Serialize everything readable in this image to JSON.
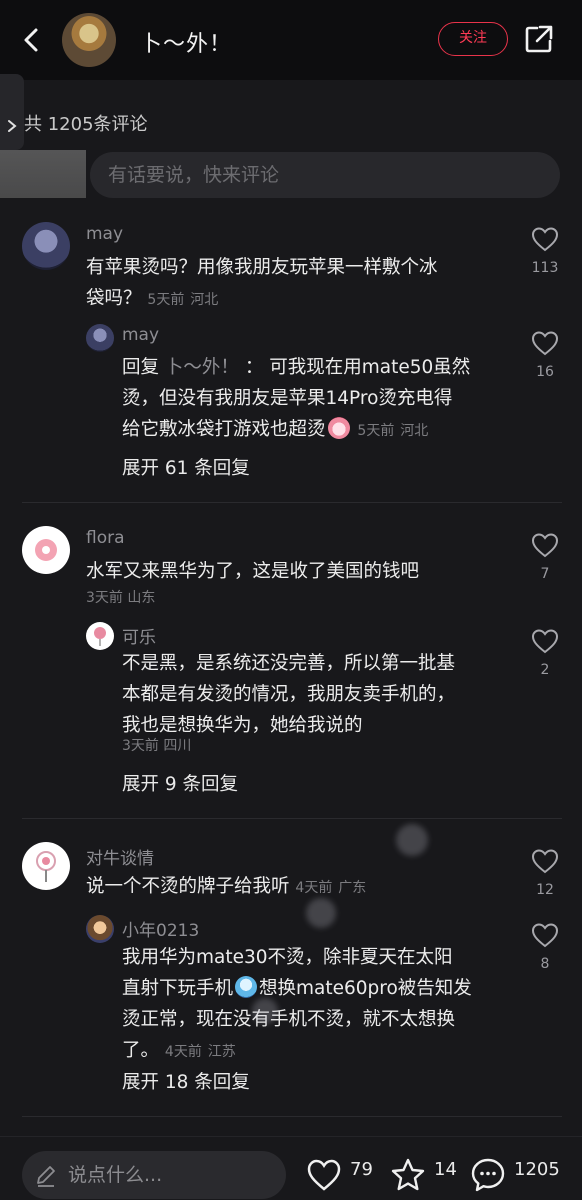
{
  "header": {
    "title": "卜～外！",
    "follow_label": "关注"
  },
  "comments_header": {
    "count_label": "共 1205条评论",
    "input_placeholder": "有话要说，快来评论"
  },
  "comments": [
    {
      "user": "may",
      "line1": "有苹果烫吗？用像我朋友玩苹果一样敷个冰",
      "line2": "袋吗？",
      "time": "5天前",
      "location": "河北",
      "likes": "113",
      "reply": {
        "user": "may",
        "prefix": "回复",
        "reply_to": "卜～外！",
        "colon": "：",
        "line1": "可我现在用mate50虽然",
        "line2": "烫，但没有我朋友是苹果14Pro烫充电得",
        "line3": "给它敷冰袋打游戏也超烫",
        "time": "5天前",
        "location": "河北",
        "likes": "16"
      },
      "expand_label": "展开 61 条回复"
    },
    {
      "user": "flora",
      "line1": "水军又来黑华为了，这是收了美国的钱吧",
      "time": "3天前",
      "location": "山东",
      "likes": "7",
      "reply": {
        "user": "可乐",
        "line1": "不是黑，是系统还没完善，所以第一批基",
        "line2": "本都是有发烫的情况，我朋友卖手机的，",
        "line3": "我也是想换华为，她给我说的",
        "time": "3天前",
        "location": "四川",
        "likes": "2"
      },
      "expand_label": "展开 9 条回复"
    },
    {
      "user": "对牛谈情",
      "line1": "说一个不烫的牌子给我听",
      "time": "4天前",
      "location": "广东",
      "likes": "12",
      "reply": {
        "user": "小年0213",
        "line1": "我用华为mate30不烫，除非夏天在太阳",
        "line2a": "直射下玩手机",
        "line2b": "想换mate60pro被告知发",
        "line3": "烫正常，现在没有手机不烫，就不太想换",
        "line4": "了。",
        "time": "4天前",
        "location": "江苏",
        "likes": "8"
      },
      "expand_label": "展开 18 条回复"
    }
  ],
  "bottom_bar": {
    "input_placeholder": "说点什么...",
    "likes": "79",
    "favorites": "14",
    "comments": "1205"
  }
}
